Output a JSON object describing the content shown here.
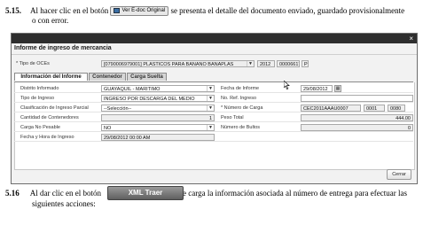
{
  "step1": {
    "number": "5.15.",
    "text_before": "Al hacer clic en el botón",
    "button_label": "Ver E-doc Original",
    "text_after": "se presenta el detalle del documento enviado, guardado provisionalmente",
    "text_line2": "o con error."
  },
  "dialog": {
    "close_glyph": "×",
    "title": "Informe de ingreso de mercancia",
    "tipo_oce_label": "* Tipo de OCEs",
    "tipo_oce_value": "[0790006979001] PLASTICOS PARA BANANO BANAPLAS",
    "year": "2012",
    "sequence": "00006617",
    "letter": "P",
    "tabs": [
      "Información del Informe",
      "Contenedor",
      "Carga Suelta"
    ],
    "left_fields": [
      {
        "label": "Distrito Informado",
        "value": "GUAYAQUIL - MARITIMO"
      },
      {
        "label": "Tipo de Ingreso",
        "value": "INGRESO POR DESCARGA DEL MEDIO"
      },
      {
        "label": "Clasificación de Ingreso Parcial",
        "value": "--Selección--"
      },
      {
        "label": "Cantidad de Contenedores",
        "value": "1"
      },
      {
        "label": "Carga No Pesable",
        "value": "NO"
      },
      {
        "label": "Fecha y Hora de Ingreso",
        "value": "29/08/2012 00:00 AM"
      }
    ],
    "right_fields": [
      {
        "label": "Fecha de Informe",
        "value": "29/08/2012"
      },
      {
        "label": "No. Ref. Ingreso",
        "value": ""
      },
      {
        "label": "* Número de Carga",
        "value": "CEC2011AAAU0007",
        "extra1": "0001",
        "extra2": "0080"
      },
      {
        "label": "Peso Total",
        "value": "444.00"
      },
      {
        "label": "Número de Bultos",
        "value": "0"
      }
    ],
    "close_button": "Cerrar"
  },
  "step2": {
    "number": "5.16",
    "text_before": "Al dar clic en el botón",
    "button_label": "XML Traer",
    "text_after": "se carga la información asociada al número de entrega para efectuar las",
    "text_line2": "siguientes acciones:"
  }
}
